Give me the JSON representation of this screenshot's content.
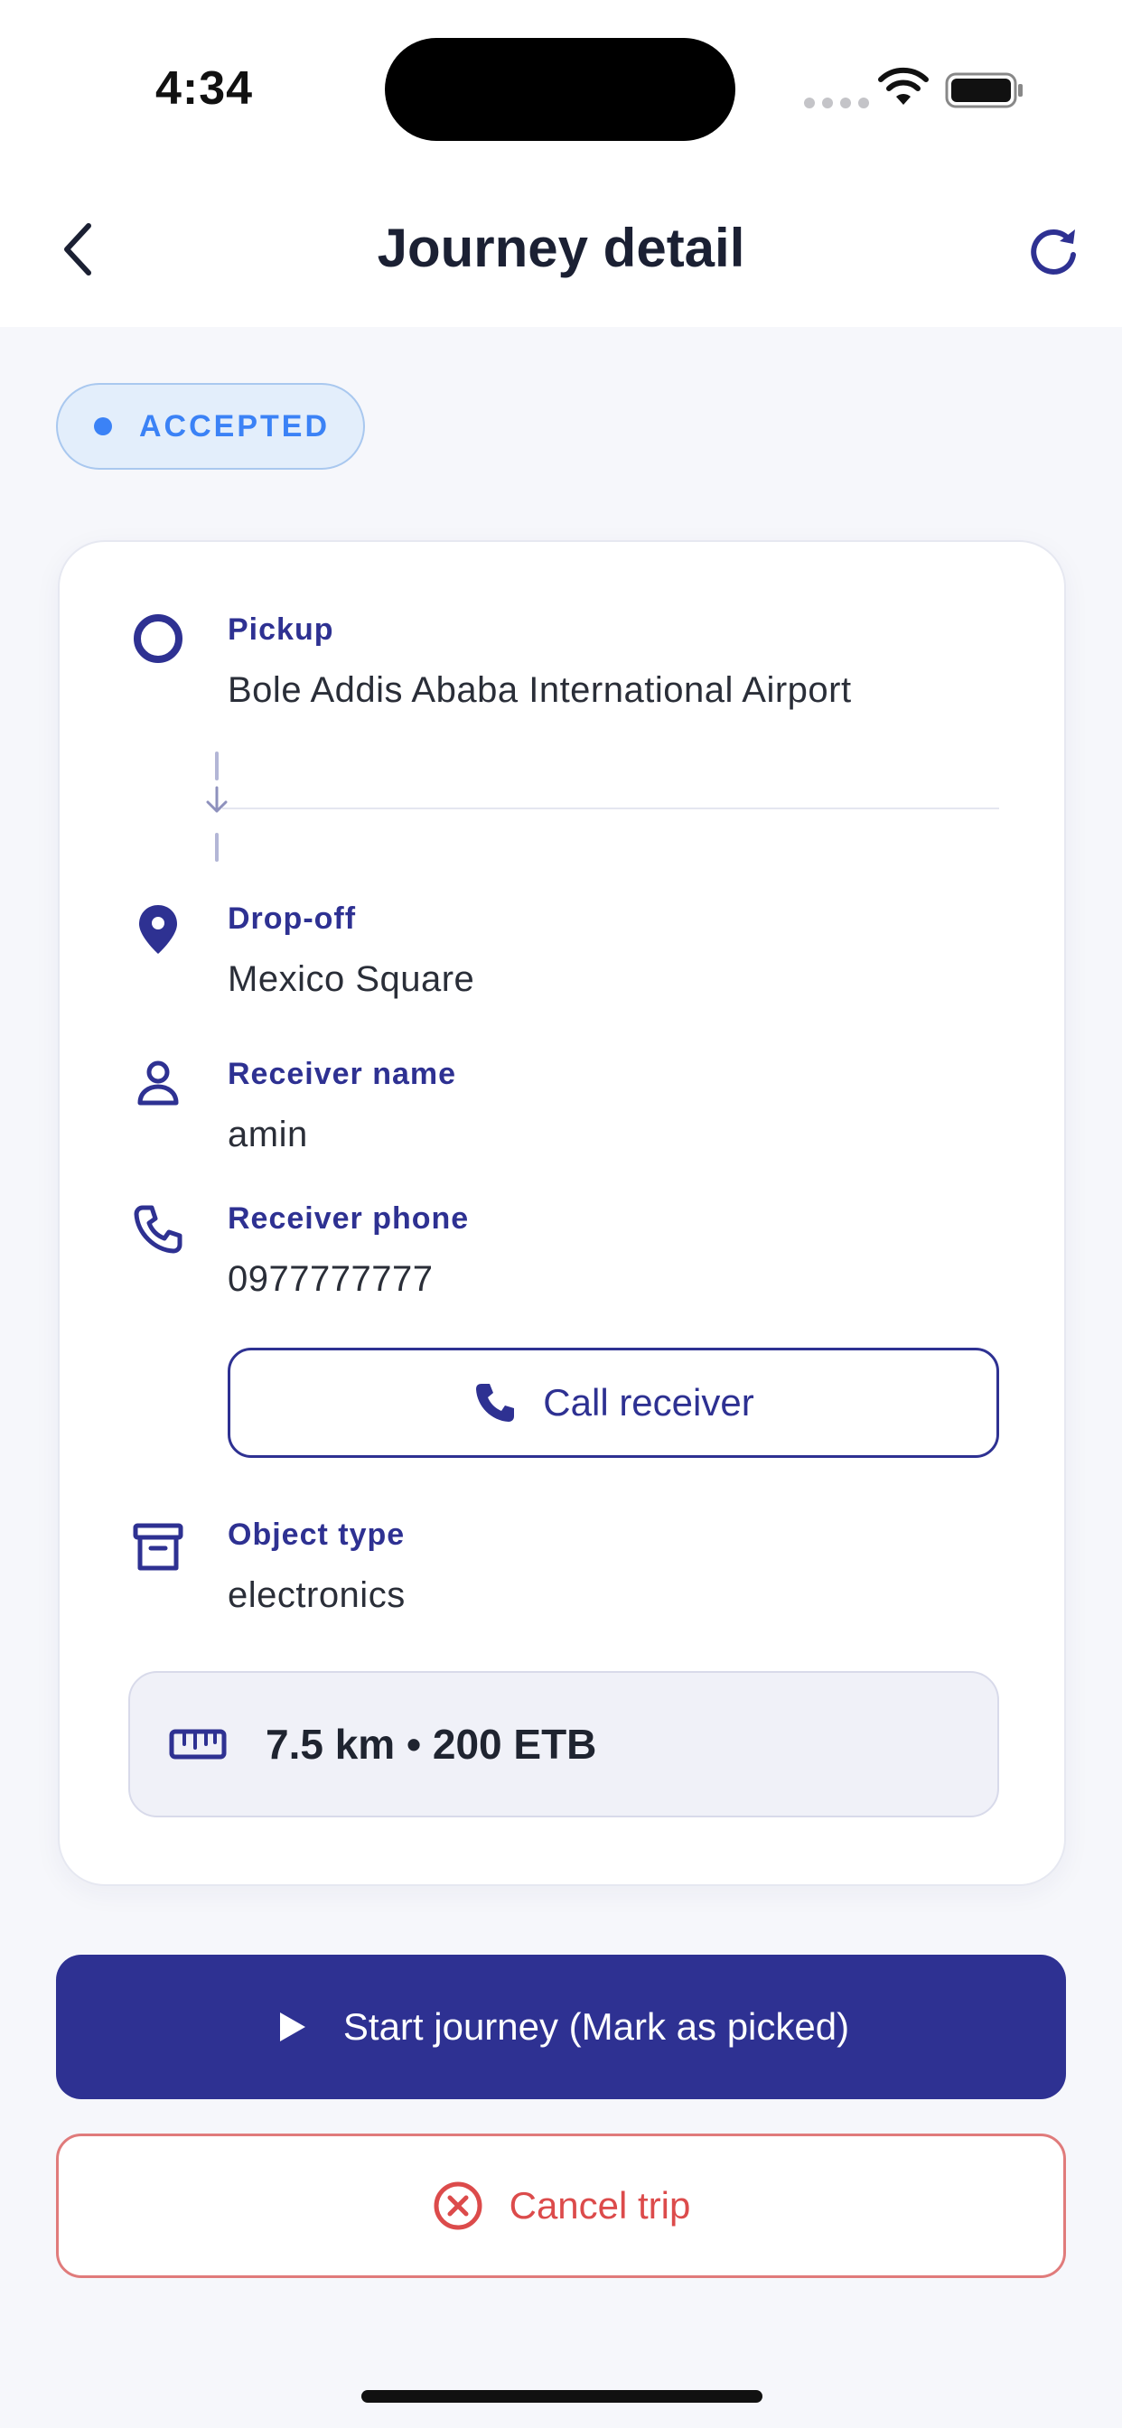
{
  "status_bar": {
    "time": "4:34"
  },
  "header": {
    "title": "Journey detail",
    "back_icon": "chevron-left-icon",
    "refresh_icon": "refresh-icon"
  },
  "status": {
    "label": "ACCEPTED",
    "color": "#3B82F6"
  },
  "trip": {
    "pickup": {
      "label": "Pickup",
      "value": "Bole Addis Ababa International Airport",
      "icon": "circle-icon"
    },
    "dropoff": {
      "label": "Drop-off",
      "value": "Mexico Square",
      "icon": "location-pin-icon"
    },
    "receiver_name": {
      "label": "Receiver name",
      "value": "amin",
      "icon": "person-icon"
    },
    "receiver_phone": {
      "label": "Receiver phone",
      "value": "0977777777",
      "icon": "phone-icon"
    },
    "call_button": {
      "label": "Call receiver",
      "icon": "phone-icon"
    },
    "object_type": {
      "label": "Object type",
      "value": "electronics",
      "icon": "archive-box-icon"
    },
    "summary": {
      "text": "7.5 km • 200 ETB",
      "icon": "ruler-icon"
    }
  },
  "actions": {
    "start": {
      "label": "Start journey (Mark as picked)",
      "icon": "play-icon"
    },
    "cancel": {
      "label": "Cancel trip",
      "icon": "x-circle-icon"
    }
  },
  "colors": {
    "primary": "#2E3192",
    "danger": "#DC4B4B",
    "accent": "#3B82F6"
  }
}
